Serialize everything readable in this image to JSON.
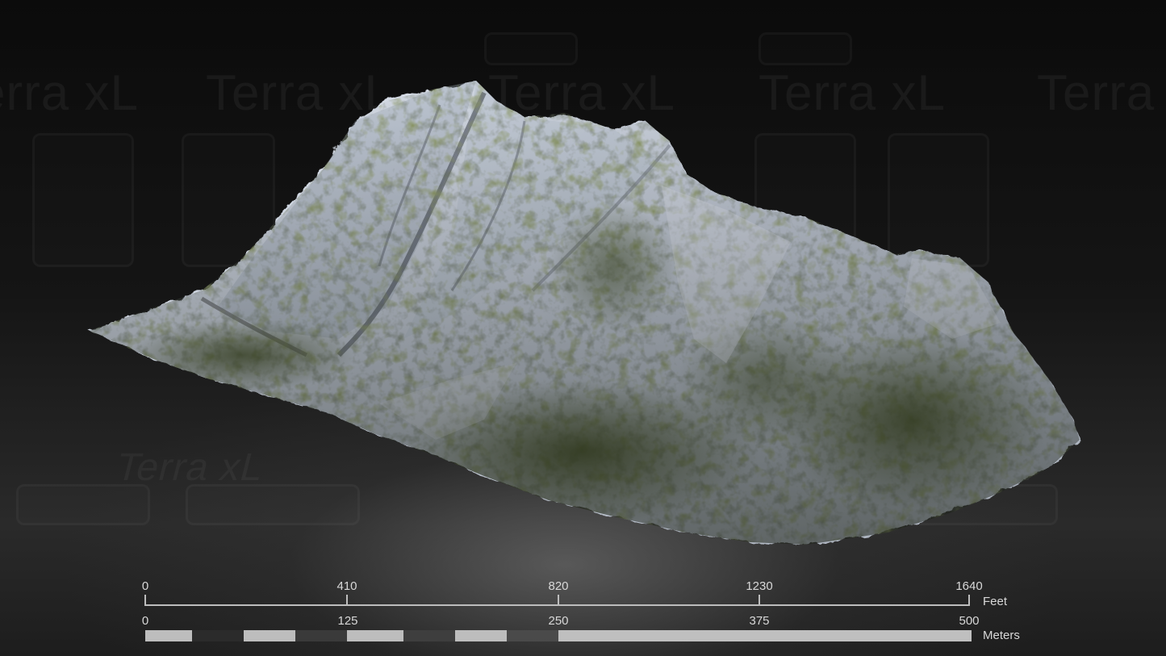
{
  "watermark": {
    "text": "Terra xL"
  },
  "scalebar": {
    "feet": {
      "ticks": [
        "0",
        "410",
        "820",
        "1230",
        "1640"
      ],
      "unit": "Feet"
    },
    "meters": {
      "ticks": [
        "0",
        "125",
        "250",
        "375",
        "500"
      ],
      "unit": "Meters",
      "segment_colors": [
        "#bdbdbd",
        "#2b2b2b",
        "#bdbdbd",
        "#3a3a3a",
        "#bdbdbd",
        "#3e3e3e",
        "#bdbdbd",
        "#4a4a4a",
        "#bfbfbf"
      ]
    }
  },
  "colors": {
    "snow": "#c9cfd9",
    "rock_shadow": "#5d6470",
    "vegetation": "#4e5a2c",
    "background": "#111111"
  }
}
